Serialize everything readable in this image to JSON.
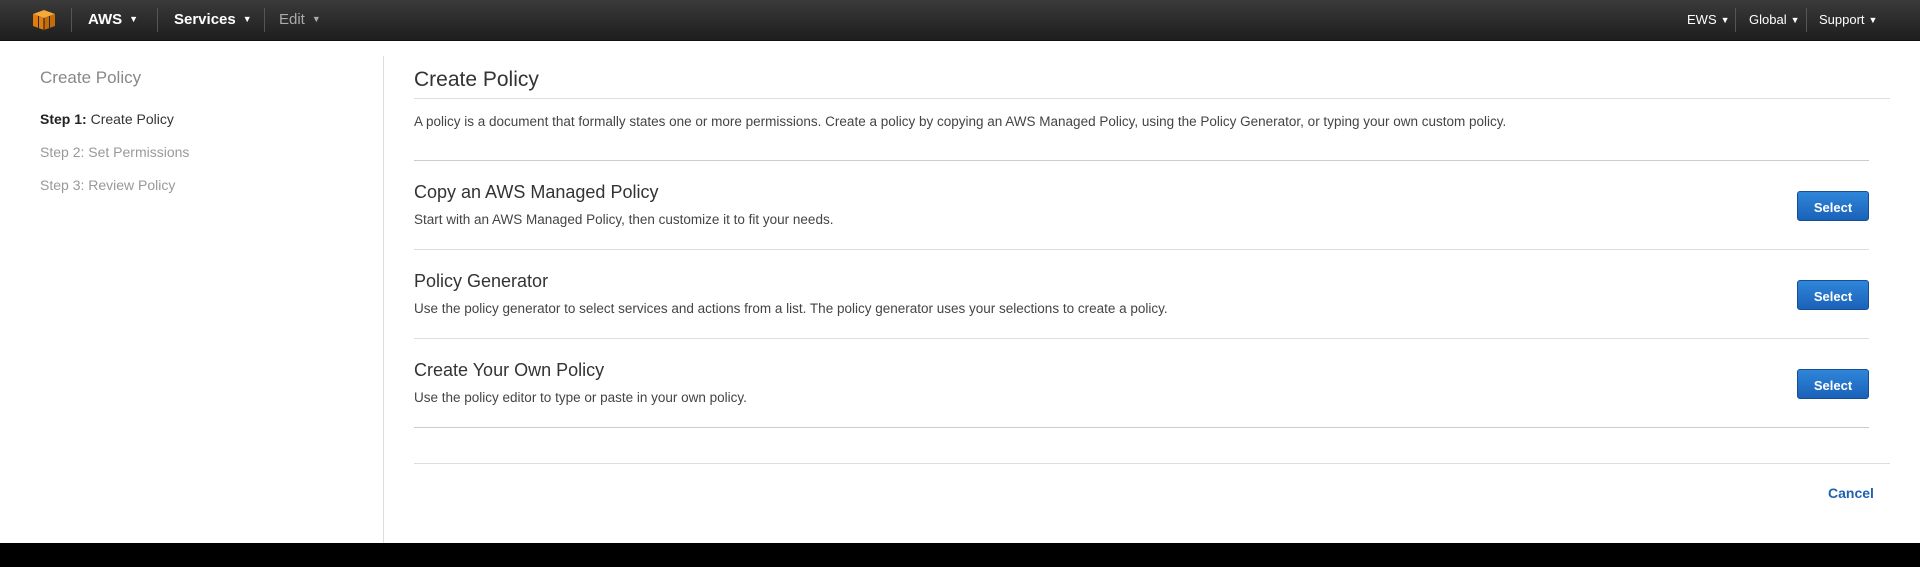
{
  "topbar": {
    "brand": "AWS",
    "services": "Services",
    "edit": "Edit",
    "account": "EWS",
    "region": "Global",
    "support": "Support"
  },
  "sidebar": {
    "title": "Create Policy",
    "steps": [
      {
        "prefix": "Step 1:",
        "label": "Create Policy"
      },
      {
        "label": "Step 2: Set Permissions"
      },
      {
        "label": "Step 3: Review Policy"
      }
    ]
  },
  "main": {
    "title": "Create Policy",
    "intro": "A policy is a document that formally states one or more permissions. Create a policy by copying an AWS Managed Policy, using the Policy Generator, or typing your own custom policy.",
    "options": [
      {
        "title": "Copy an AWS Managed Policy",
        "desc": "Start with an AWS Managed Policy, then customize it to fit your needs.",
        "button": "Select"
      },
      {
        "title": "Policy Generator",
        "desc": "Use the policy generator to select services and actions from a list. The policy generator uses your selections to create a policy.",
        "button": "Select"
      },
      {
        "title": "Create Your Own Policy",
        "desc": "Use the policy editor to type or paste in your own policy.",
        "button": "Select"
      }
    ],
    "cancel": "Cancel"
  },
  "colors": {
    "topbar": "#2b2b2b",
    "accent": "#1f63b0",
    "logo": "#f7981d"
  },
  "icons": {
    "logo": "aws-cube-icon",
    "caret": "caret-down-icon"
  }
}
